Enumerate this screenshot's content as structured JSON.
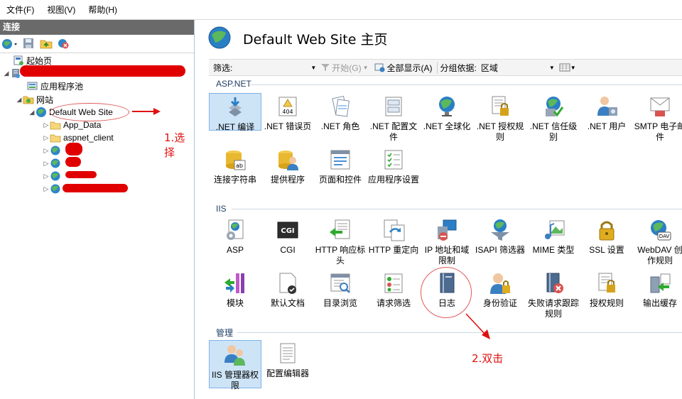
{
  "menu": [
    "文件(F)",
    "视图(V)",
    "帮助(H)"
  ],
  "left_pane": {
    "header": "连接",
    "tree": {
      "start_page": "起始页",
      "app_pools": "应用程序池",
      "sites": "网站",
      "default_site": "Default Web Site",
      "app_data": "App_Data",
      "aspnet_client": "aspnet_client"
    }
  },
  "annotations": {
    "step1": "1.选择",
    "step2": "2.双击"
  },
  "right_pane": {
    "title": "Default Web Site 主页",
    "filter": {
      "label": "筛选:",
      "start": "开始(G)",
      "show_all": "全部显示(A)",
      "group_by_label": "分组依据:",
      "group_by_value": "区域"
    },
    "sections": {
      "aspnet": {
        "title": "ASP.NET",
        "items": [
          ".NET 编译",
          ".NET 错误页",
          ".NET 角色",
          ".NET 配置文件",
          ".NET 全球化",
          ".NET 授权规则",
          ".NET 信任级别",
          ".NET 用户",
          "SMTP 电子邮件",
          "连接字符串",
          "提供程序",
          "页面和控件",
          "应用程序设置"
        ]
      },
      "iis": {
        "title": "IIS",
        "items": [
          "ASP",
          "CGI",
          "HTTP 响应标头",
          "HTTP 重定向",
          "IP 地址和域限制",
          "ISAPI 筛选器",
          "MIME 类型",
          "SSL 设置",
          "WebDAV 创作规则",
          "模块",
          "默认文档",
          "目录浏览",
          "请求筛选",
          "日志",
          "身份验证",
          "失败请求跟踪规则",
          "授权规则",
          "输出缓存"
        ]
      },
      "manage": {
        "title": "管理",
        "items": [
          "IIS 管理器权限",
          "配置编辑器"
        ]
      }
    }
  }
}
